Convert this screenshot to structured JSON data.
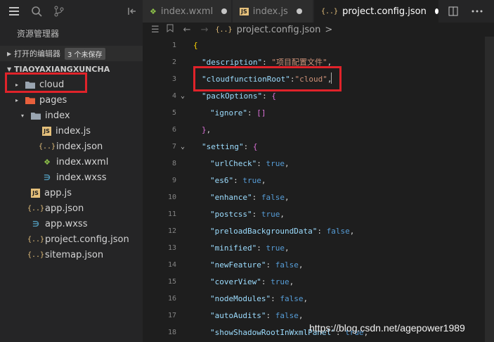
{
  "sidebar": {
    "title": "资源管理器",
    "open_editors": {
      "label": "打开的编辑器",
      "badge": "3 个未保存"
    },
    "project": {
      "name": "TIAOYAXIANGXUNCHA"
    },
    "tree": [
      {
        "label": "cloud",
        "icon": "folder-icon",
        "twisty": "▸",
        "indent": 0
      },
      {
        "label": "pages",
        "icon": "folder-icon",
        "twisty": "▸",
        "indent": 0
      },
      {
        "label": "index",
        "icon": "folder-icon",
        "twisty": "▾",
        "indent": 1
      },
      {
        "label": "index.js",
        "icon": "js-icon",
        "twisty": "",
        "indent": 2
      },
      {
        "label": "index.json",
        "icon": "json-icon",
        "twisty": "",
        "indent": 2
      },
      {
        "label": "index.wxml",
        "icon": "wxml-icon",
        "twisty": "",
        "indent": 2
      },
      {
        "label": "index.wxss",
        "icon": "wxss-icon",
        "twisty": "",
        "indent": 2
      },
      {
        "label": "app.js",
        "icon": "js-icon",
        "twisty": "",
        "indent": 1
      },
      {
        "label": "app.json",
        "icon": "json-icon",
        "twisty": "",
        "indent": 1
      },
      {
        "label": "app.wxss",
        "icon": "wxss-icon",
        "twisty": "",
        "indent": 1
      },
      {
        "label": "project.config.json",
        "icon": "json-icon",
        "twisty": "",
        "indent": 1
      },
      {
        "label": "sitemap.json",
        "icon": "json-icon",
        "twisty": "",
        "indent": 1
      }
    ]
  },
  "tabs": [
    {
      "label": "index.wxml",
      "icon": "wxml-icon",
      "unsaved": true,
      "active": false
    },
    {
      "label": "index.js",
      "icon": "js-icon",
      "unsaved": true,
      "active": false
    },
    {
      "label": "project.config.json",
      "icon": "json-icon",
      "unsaved": true,
      "active": true
    }
  ],
  "breadcrumb": {
    "file": "project.config.json",
    "separator": ">"
  },
  "editor": {
    "lines": [
      {
        "n": "1",
        "fold": "",
        "code": "{"
      },
      {
        "n": "2",
        "fold": "",
        "code": "\"description\": \"项目配置文件\","
      },
      {
        "n": "3",
        "fold": "",
        "code": "\"cloudfunctionRoot\":\"cloud\","
      },
      {
        "n": "4",
        "fold": "⌄",
        "code": "\"packOptions\": {"
      },
      {
        "n": "5",
        "fold": "",
        "code": "\"ignore\": []"
      },
      {
        "n": "6",
        "fold": "",
        "code": "},"
      },
      {
        "n": "7",
        "fold": "⌄",
        "code": "\"setting\": {"
      },
      {
        "n": "8",
        "fold": "",
        "code": "\"urlCheck\": true,"
      },
      {
        "n": "9",
        "fold": "",
        "code": "\"es6\": true,"
      },
      {
        "n": "10",
        "fold": "",
        "code": "\"enhance\": false,"
      },
      {
        "n": "11",
        "fold": "",
        "code": "\"postcss\": true,"
      },
      {
        "n": "12",
        "fold": "",
        "code": "\"preloadBackgroundData\": false,"
      },
      {
        "n": "13",
        "fold": "",
        "code": "\"minified\": true,"
      },
      {
        "n": "14",
        "fold": "",
        "code": "\"newFeature\": false,"
      },
      {
        "n": "15",
        "fold": "",
        "code": "\"coverView\": true,"
      },
      {
        "n": "16",
        "fold": "",
        "code": "\"nodeModules\": false,"
      },
      {
        "n": "17",
        "fold": "",
        "code": "\"autoAudits\": false,"
      },
      {
        "n": "18",
        "fold": "",
        "code": "\"showShadowRootInWxmlPanel\": true,"
      }
    ]
  },
  "watermark": "https://blog.csdn.net/agepower1989",
  "colors": {
    "highlight_box": "#e0232a",
    "editor_bg": "#1e1e1e",
    "sidebar_bg": "#252526"
  }
}
